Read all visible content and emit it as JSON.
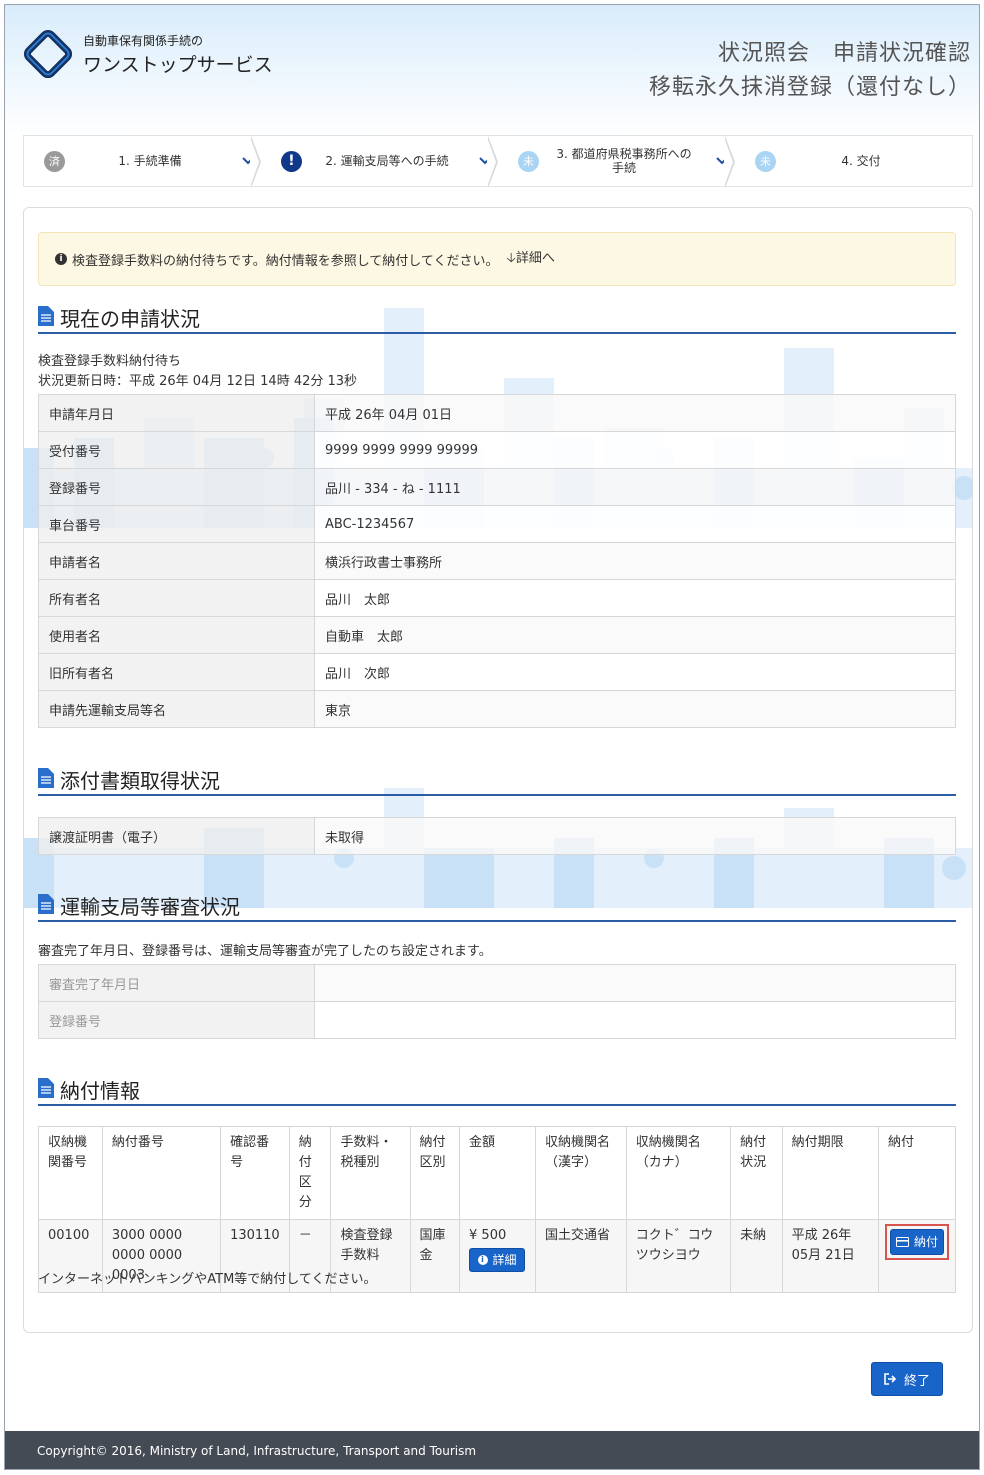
{
  "header": {
    "logo_small": "自動車保有関係手続の",
    "logo_big": "ワンストップサービス",
    "title_line1": "状況照会　申請状況確認",
    "title_line2": "移転永久抹消登録（還付なし）"
  },
  "steps": [
    {
      "badge": "済",
      "label": "1. 手続準備",
      "state": "done"
    },
    {
      "badge": "!",
      "label": "2. 運輸支局等への手続",
      "state": "current"
    },
    {
      "badge": "未",
      "label": "3. 都道府県税事務所への手続",
      "state": "todo"
    },
    {
      "badge": "未",
      "label": "4. 交付",
      "state": "todo"
    }
  ],
  "alert": {
    "message": "検査登録手数料の納付待ちです。納付情報を参照して納付してください。",
    "link": "詳細へ"
  },
  "status_section": {
    "title": "現在の申請状況",
    "status_text": "検査登録手数料納付待ち",
    "updated_text": "状況更新日時：平成 26年 04月 12日 14時 42分 13秒",
    "rows": [
      {
        "key": "申請年月日",
        "value": "平成 26年 04月 01日"
      },
      {
        "key": "受付番号",
        "value": "9999 9999 9999 99999"
      },
      {
        "key": "登録番号",
        "value": "品川 - 334 - ね - 1111"
      },
      {
        "key": "車台番号",
        "value": "ABC-1234567"
      },
      {
        "key": "申請者名",
        "value": "横浜行政書士事務所"
      },
      {
        "key": "所有者名",
        "value": "品川　太郎"
      },
      {
        "key": "使用者名",
        "value": "自動車　太郎"
      },
      {
        "key": "旧所有者名",
        "value": "品川　次郎"
      },
      {
        "key": "申請先運輸支局等名",
        "value": "東京"
      }
    ]
  },
  "attachment_section": {
    "title": "添付書類取得状況",
    "rows": [
      {
        "key": "譲渡証明書（電子）",
        "value": "未取得"
      }
    ]
  },
  "review_section": {
    "title": "運輸支局等審査状況",
    "note": "審査完了年月日、登録番号は、運輸支局等審査が完了したのち設定されます。",
    "rows": [
      {
        "key": "審査完了年月日",
        "value": ""
      },
      {
        "key": "登録番号",
        "value": ""
      }
    ]
  },
  "payment_section": {
    "title": "納付情報",
    "headers": [
      "収納機関番号",
      "納付番号",
      "確認番号",
      "納付区分",
      "手数料・税種別",
      "納付区別",
      "金額",
      "収納機関名（漢字）",
      "収納機関名（カナ）",
      "納付状況",
      "納付期限",
      "納付"
    ],
    "row": {
      "agency_no": "00100",
      "payment_no": "3000 0000 0000 0000 0003",
      "confirm_no": "130110",
      "payment_type": "－",
      "fee_type": "検査登録手数料",
      "category": "国庫金",
      "amount": "¥ 500",
      "detail_button": "詳細",
      "agency_kanji": "国土交通省",
      "agency_kana": "コクト゛コウツウシヨウ",
      "status": "未納",
      "deadline": "平成 26年 05月 21日",
      "pay_button": "納付"
    },
    "footer_note": "インターネットバンキングやATM等で納付してください。"
  },
  "end_button": "終了",
  "copyright": "Copyright© 2016, Ministry of Land, Infrastructure, Transport and Tourism"
}
